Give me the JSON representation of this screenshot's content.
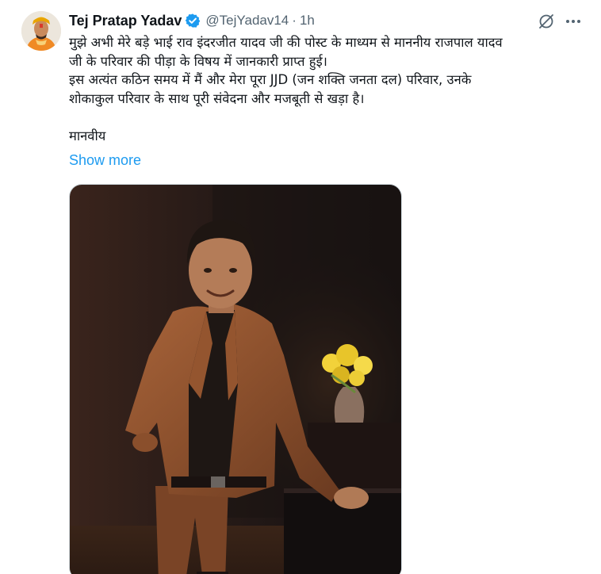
{
  "tweet": {
    "author_name": "Tej Pratap Yadav",
    "handle": "@TejYadav14",
    "separator": "·",
    "time": "1h",
    "text_lines": [
      "मुझे अभी मेरे बड़े भाई राव इंदरजीत यादव जी की पोस्ट के माध्यम से माननीय राजपाल यादव",
      "जी के परिवार की पीड़ा के विषय में जानकारी प्राप्त हुई।",
      "इस अत्यंत कठिन समय में मैं और मेरा पूरा JJD (जन शक्ति जनता दल) परिवार, उनके",
      "शोकाकुल परिवार के साथ पूरी संवेदना और मजबूती से खड़ा है।",
      "मानवीय"
    ],
    "show_more": "Show more"
  },
  "icons": {
    "verified": "verified-badge-icon",
    "grok": "grok-icon",
    "more": "more-options-icon"
  },
  "colors": {
    "text": "#0f1419",
    "secondary": "#536471",
    "link": "#1d9bf0",
    "verified": "#1d9bf0",
    "border": "#cfd9de"
  }
}
